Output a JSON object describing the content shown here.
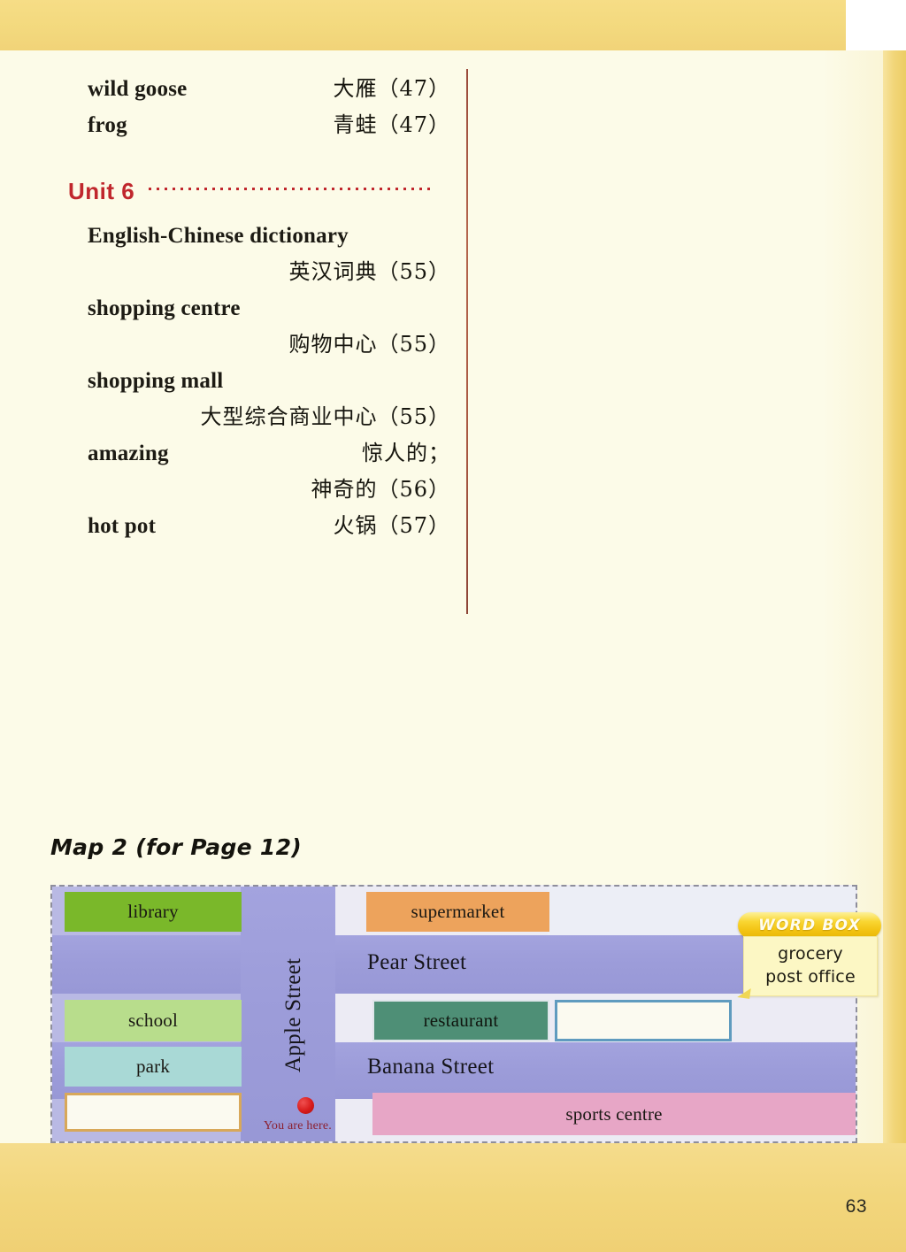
{
  "page": {
    "number": "63",
    "accent_red": "#c0272d",
    "band_yellow": "#f2d67c",
    "sheet_cream": "#fcfbe8"
  },
  "vocabulary": {
    "continued_entries": [
      {
        "english": "wild goose",
        "chinese": "大雁（47）"
      },
      {
        "english": "frog",
        "chinese": "青蛙（47）"
      }
    ],
    "unit": {
      "label": "Unit 6",
      "entries": [
        {
          "english": "English-Chinese dictionary",
          "chinese": "英汉词典（55）"
        },
        {
          "english": "shopping centre",
          "chinese": "购物中心（55）"
        },
        {
          "english": "shopping mall",
          "chinese": "大型综合商业中心（55）"
        },
        {
          "english": "amazing",
          "chinese": "惊人的；",
          "chinese2": "神奇的（56）"
        },
        {
          "english": "hot pot",
          "chinese": "火锅（57）"
        }
      ]
    }
  },
  "map_section": {
    "title": "Map 2 (for Page 12)",
    "streets": {
      "vertical": "Apple Street",
      "upper": "Pear Street",
      "lower": "Banana Street"
    },
    "you_are_here": {
      "label": "You are here.",
      "dot_color": "#d81b1b"
    },
    "blocks": [
      {
        "label": "library",
        "color": "#7ab82a"
      },
      {
        "label": "supermarket",
        "color": "#eda35c"
      },
      {
        "label": "school",
        "color": "#b8dd8c"
      },
      {
        "label": "restaurant",
        "color": "#4e8f76"
      },
      {
        "label": "park",
        "color": "#a9d9d6"
      },
      {
        "label": "sports centre",
        "color": "#e7a6c6"
      }
    ],
    "empty_boxes": [
      {
        "name": "blank-block-lower-left",
        "border_color": "#d8a85a"
      },
      {
        "name": "blank-block-middle-right",
        "border_color": "#5f9bbf"
      }
    ],
    "word_box": {
      "title": "WORD BOX",
      "words": [
        "grocery",
        "post office"
      ]
    }
  }
}
